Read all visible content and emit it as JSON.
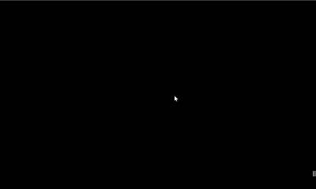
{
  "screen": {
    "state": "blank",
    "background_color": "#000000"
  },
  "cursor": {
    "icon": "arrow-cursor-icon",
    "color": "#ffffff"
  },
  "corner_indicator": {
    "icon": "resize-grip-icon",
    "color": "#5a5a5a"
  }
}
